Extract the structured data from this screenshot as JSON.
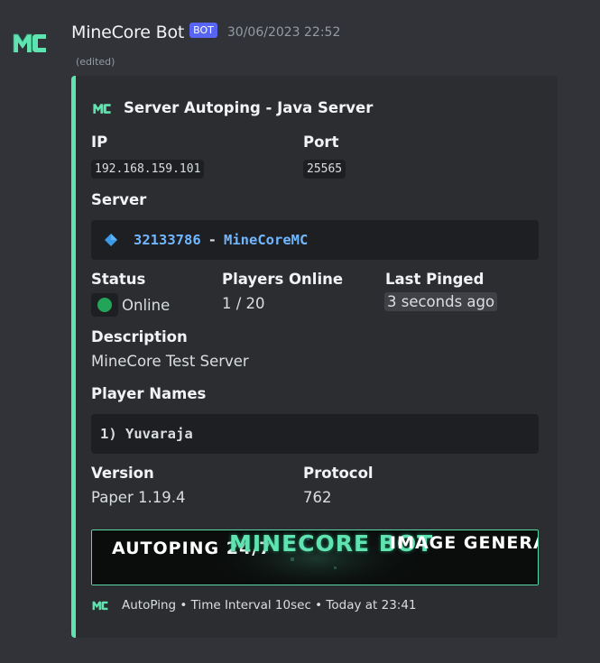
{
  "message": {
    "username": "MineCore Bot",
    "badge": "BOT",
    "timestamp": "30/06/2023 22:52",
    "edited": "(edited)"
  },
  "embed": {
    "accent_color": "#5fe3b0",
    "title": "Server Autoping - Java Server",
    "fields": {
      "ip": {
        "label": "IP",
        "value": "192.168.159.101"
      },
      "port": {
        "label": "Port",
        "value": "25565"
      },
      "server": {
        "label": "Server",
        "icon": "diamond-icon",
        "id": "32133786",
        "separator": "-",
        "name": "MineCoreMC"
      },
      "status": {
        "label": "Status",
        "value": "Online",
        "color": "#23a559"
      },
      "players_online": {
        "label": "Players Online",
        "value": "1 / 20"
      },
      "last_pinged": {
        "label": "Last Pinged",
        "value": "3 seconds ago"
      },
      "description": {
        "label": "Description",
        "value": "MineCore Test Server"
      },
      "player_names": {
        "label": "Player Names",
        "value": "1) Yuvaraja"
      },
      "version": {
        "label": "Version",
        "value": "Paper 1.19.4"
      },
      "protocol": {
        "label": "Protocol",
        "value": "762"
      }
    },
    "banner": {
      "left_text": "AUTOPING 24/7",
      "center_text": "MINECORE BOT",
      "right_text": "IMAGE GENERATION"
    },
    "footer": {
      "text": "AutoPing • Time Interval 10sec • Today at 23:41"
    }
  }
}
